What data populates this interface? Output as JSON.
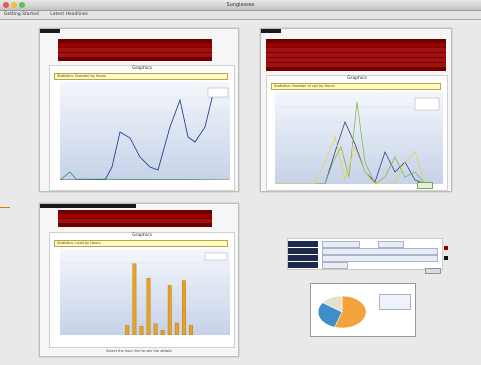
{
  "window": {
    "title": "Sunglasses"
  },
  "bookmarks": [
    "Getting Started",
    "Latest Headlines"
  ],
  "panels": {
    "top_left": {
      "chart_title": "Graphics",
      "subtitle": "Statistics: Number by Hours",
      "legend": [
        "",
        ""
      ]
    },
    "top_right": {
      "chart_title": "Graphics",
      "subtitle": "Statistics: Number of call by Hours",
      "legend": [
        "",
        "",
        ""
      ]
    },
    "bottom_left": {
      "chart_title": "Graphics",
      "subtitle": "Statistics: Load by Hours",
      "legend": [
        ""
      ],
      "footer": "Select the hour line to see the details",
      "values": [
        0,
        0,
        0,
        0,
        0,
        0,
        0,
        0,
        0,
        1.2,
        8.9,
        1.1,
        7.1,
        1.4,
        0.6,
        6.2,
        1.5,
        6.8,
        1.2,
        0,
        0,
        0,
        0,
        0
      ]
    },
    "form": {
      "labels": [
        "",
        "",
        "",
        ""
      ],
      "field_values": [
        "",
        "",
        "",
        ""
      ],
      "submit": ""
    },
    "pie": {
      "title": "",
      "values": [
        55,
        30,
        15
      ],
      "colors": [
        "#f2a33b",
        "#3e8fc7",
        "#e7e0c8"
      ],
      "legend": [
        "",
        "",
        ""
      ]
    }
  }
}
